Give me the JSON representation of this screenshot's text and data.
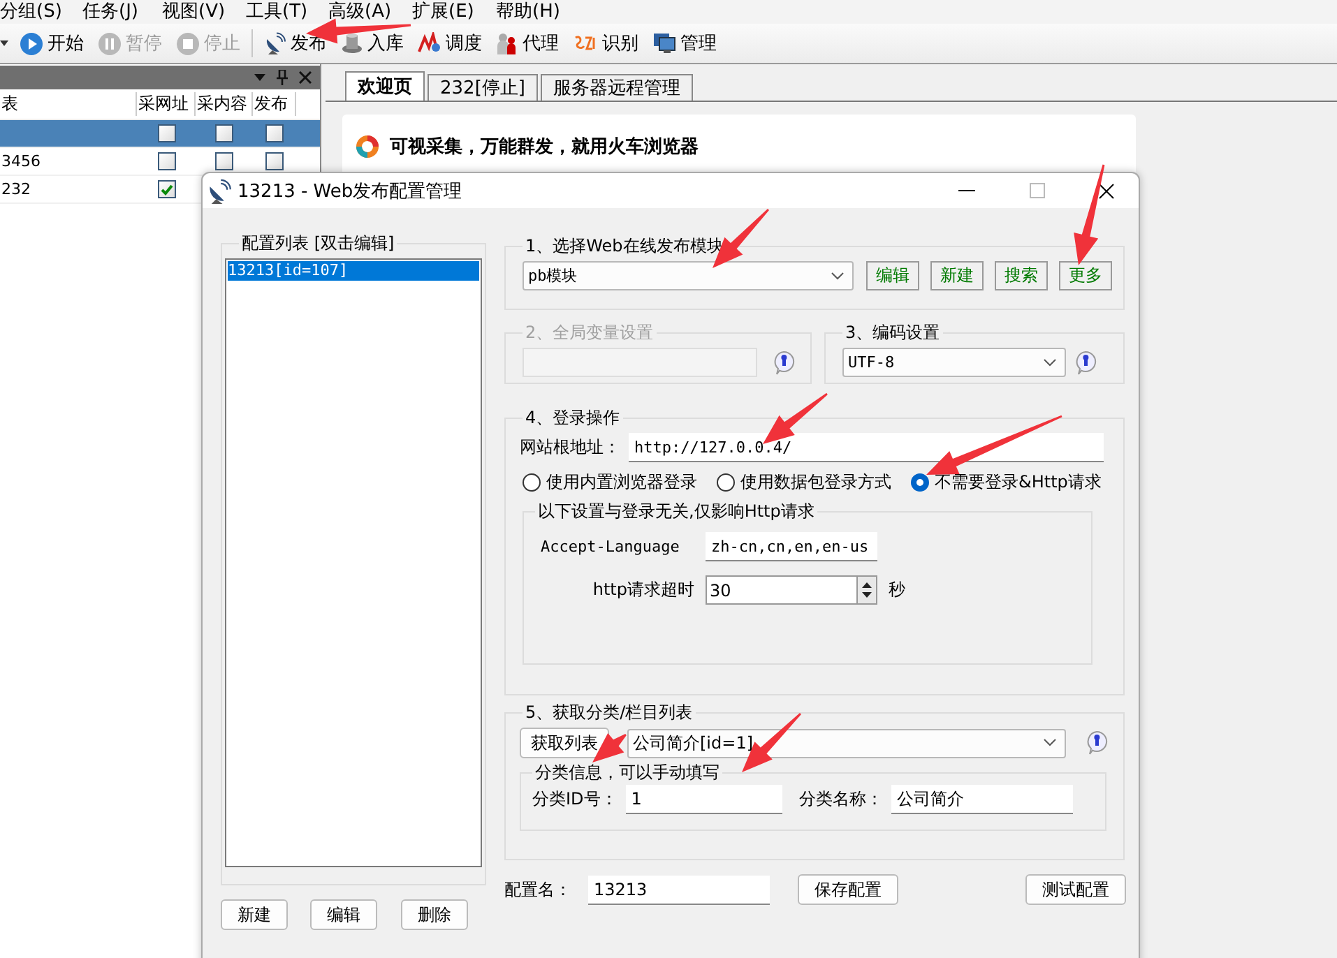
{
  "menu": [
    "分组(S)",
    "任务(J)",
    "视图(V)",
    "工具(T)",
    "高级(A)",
    "扩展(E)",
    "帮助(H)"
  ],
  "toolbar": [
    {
      "label": "开始",
      "kind": "play",
      "disabled": false
    },
    {
      "label": "暂停",
      "kind": "pause",
      "disabled": true
    },
    {
      "label": "停止",
      "kind": "stop",
      "disabled": true
    },
    {
      "label": "发布",
      "kind": "dish",
      "disabled": false
    },
    {
      "label": "入库",
      "kind": "store",
      "disabled": false
    },
    {
      "label": "调度",
      "kind": "schedule",
      "disabled": false
    },
    {
      "label": "代理",
      "kind": "proxy",
      "disabled": false
    },
    {
      "label": "识别",
      "kind": "recognize",
      "disabled": false
    },
    {
      "label": "管理",
      "kind": "monitor",
      "disabled": false
    }
  ],
  "left_panel": {
    "columns": [
      "表",
      "采网址",
      "采内容",
      "发布"
    ],
    "rows": [
      {
        "selected": true,
        "cells": [
          {
            "checked": false
          },
          {
            "checked": false
          },
          {
            "checked": false
          }
        ]
      },
      {
        "name": "3456",
        "selected": false,
        "cells": [
          {
            "checked": false
          },
          {
            "checked": false
          },
          {
            "checked": false
          }
        ]
      },
      {
        "name": "232",
        "selected": false,
        "cells": [
          {
            "checked": true
          }
        ]
      }
    ]
  },
  "tabs": [
    {
      "label": "欢迎页",
      "selected": true
    },
    {
      "label": "232[停止]",
      "selected": false
    },
    {
      "label": "服务器远程管理",
      "selected": false
    }
  ],
  "welcome": {
    "headline": "可视采集，万能群发，就用火车浏览器"
  },
  "dialog": {
    "title": "13213 - Web发布配置管理",
    "config_list": {
      "label": "配置列表 [双击编辑]",
      "items": [
        {
          "label": "13213[id=107]",
          "selected": true
        }
      ]
    },
    "module": {
      "label": "1、选择Web在线发布模块",
      "value": "pb模块",
      "buttons": [
        "编辑",
        "新建",
        "搜索",
        "更多"
      ]
    },
    "global_vars": {
      "label": "2、全局变量设置",
      "disabled": true
    },
    "encoding": {
      "label": "3、编码设置",
      "value": "UTF-8"
    },
    "login": {
      "label": "4、登录操作",
      "url_label": "网站根地址：",
      "url": "http://127.0.0.4/",
      "options": [
        {
          "label": "使用内置浏览器登录",
          "selected": false
        },
        {
          "label": "使用数据包登录方式",
          "selected": false
        },
        {
          "label": "不需要登录&Http请求",
          "selected": true
        }
      ],
      "http": {
        "label": "以下设置与登录无关,仅影响Http请求",
        "accept_label": "Accept-Language",
        "accept": "zh-cn,cn,en,en-us",
        "timeout_label": "http请求超时",
        "timeout": "30",
        "unit": "秒"
      }
    },
    "category": {
      "label": "5、获取分类/栏目列表",
      "button": "获取列表",
      "value": "公司简介[id=1]",
      "info": {
        "label": "分类信息，可以手动填写",
        "id_label": "分类ID号：",
        "id": "1",
        "name_label": "分类名称：",
        "name": "公司简介"
      }
    },
    "bottom": {
      "buttons": [
        "新建",
        "编辑",
        "删除"
      ],
      "name_label": "配置名：",
      "name": "13213",
      "save": "保存配置",
      "test": "测试配置"
    }
  }
}
